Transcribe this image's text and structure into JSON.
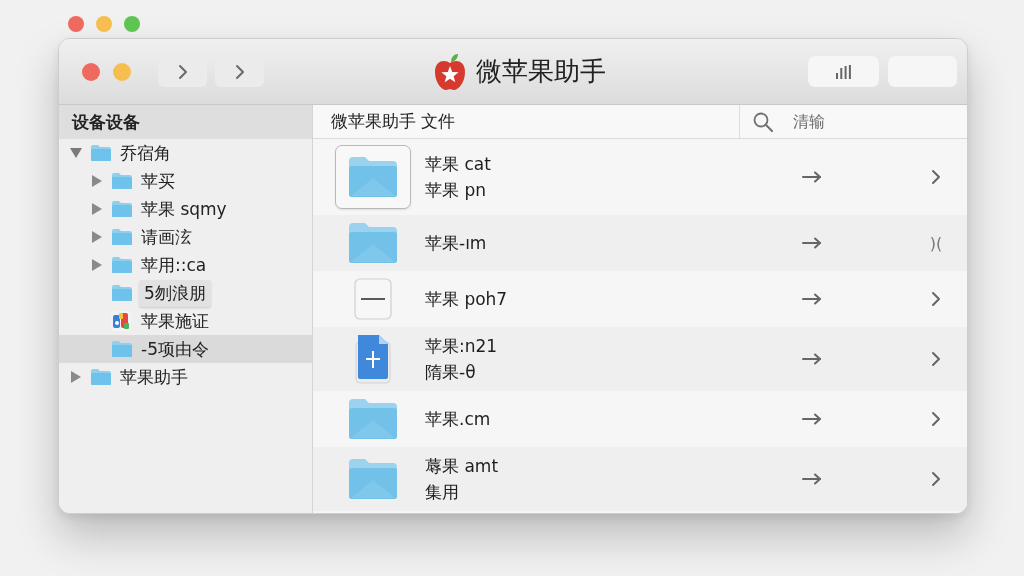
{
  "window": {
    "title": "微苹果助手"
  },
  "sidebar": {
    "title": "设备设备",
    "items": [
      {
        "label": "乔宿角",
        "kind": "folder",
        "expanded": true,
        "selected": false,
        "hovered": false,
        "children": [
          {
            "label": "苹买",
            "kind": "folder",
            "expanded": false,
            "selected": false,
            "hovered": false
          },
          {
            "label": "苹果 sqmy",
            "kind": "folder",
            "expanded": false,
            "selected": false,
            "hovered": false
          },
          {
            "label": "请画泫",
            "kind": "folder",
            "expanded": false,
            "selected": false,
            "hovered": false
          },
          {
            "label": "苹用::ca",
            "kind": "folder",
            "expanded": false,
            "selected": false,
            "hovered": false
          },
          {
            "label": "5刎浪朋",
            "kind": "folder",
            "selected": false,
            "hovered": true
          },
          {
            "label": "苹果施证",
            "kind": "app",
            "selected": false,
            "hovered": false
          },
          {
            "label": "-5项由令",
            "kind": "folder",
            "selected": true,
            "hovered": false
          }
        ]
      },
      {
        "label": "苹果助手",
        "kind": "folder",
        "expanded": false,
        "selected": false,
        "hovered": false
      }
    ]
  },
  "content": {
    "path": "微苹果助手 文件",
    "search": {
      "placeholder": "清输"
    },
    "rows": [
      {
        "kind": "folder",
        "selected": true,
        "lines": [
          "苹果 cat",
          "苹果 pn"
        ]
      },
      {
        "kind": "folder",
        "selected": false,
        "lines": [
          "苹果-ım"
        ],
        "trailing": ")("
      },
      {
        "kind": "blank",
        "selected": false,
        "lines": [
          "苹果 poh7"
        ]
      },
      {
        "kind": "document",
        "selected": false,
        "lines": [
          "苹果:n21",
          "隋果-θ"
        ]
      },
      {
        "kind": "folder",
        "selected": false,
        "lines": [
          "苹果.cm"
        ]
      },
      {
        "kind": "folder",
        "selected": false,
        "lines": [
          "蓐果 amt",
          "集用"
        ]
      }
    ]
  }
}
